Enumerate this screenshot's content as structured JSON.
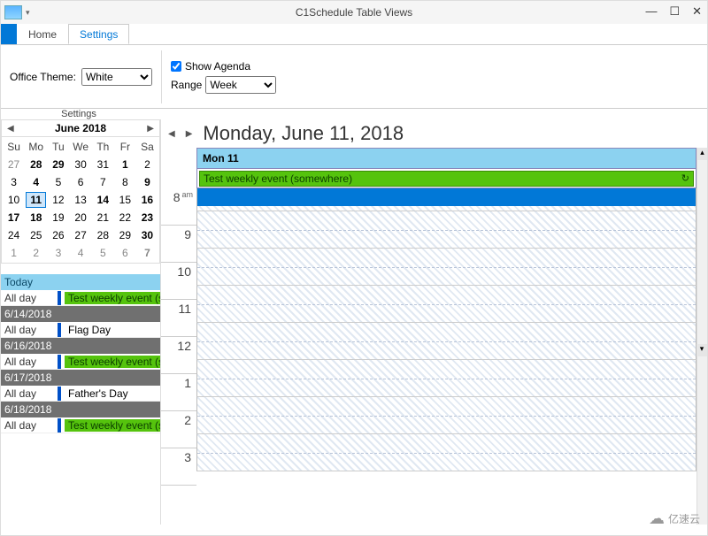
{
  "window": {
    "title": "C1Schedule Table Views"
  },
  "ribbon": {
    "tabs": {
      "home": "Home",
      "settings": "Settings"
    },
    "theme_label": "Office Theme:",
    "theme_value": "White",
    "show_agenda": "Show Agenda",
    "range_label": "Range",
    "range_value": "Week",
    "group_label": "Settings"
  },
  "calendar": {
    "month_label": "June  2018",
    "dow": [
      "Su",
      "Mo",
      "Tu",
      "We",
      "Th",
      "Fr",
      "Sa"
    ],
    "weeks": [
      [
        {
          "d": "27",
          "dim": true
        },
        {
          "d": "28",
          "bold": true
        },
        {
          "d": "29",
          "bold": true
        },
        {
          "d": "30"
        },
        {
          "d": "31"
        },
        {
          "d": "1",
          "bold": true
        },
        {
          "d": "2"
        }
      ],
      [
        {
          "d": "3"
        },
        {
          "d": "4",
          "bold": true
        },
        {
          "d": "5"
        },
        {
          "d": "6"
        },
        {
          "d": "7"
        },
        {
          "d": "8"
        },
        {
          "d": "9",
          "bold": true
        }
      ],
      [
        {
          "d": "10"
        },
        {
          "d": "11",
          "sel": true,
          "bold": true
        },
        {
          "d": "12"
        },
        {
          "d": "13"
        },
        {
          "d": "14",
          "bold": true
        },
        {
          "d": "15"
        },
        {
          "d": "16",
          "bold": true
        }
      ],
      [
        {
          "d": "17",
          "bold": true
        },
        {
          "d": "18",
          "bold": true
        },
        {
          "d": "19"
        },
        {
          "d": "20"
        },
        {
          "d": "21"
        },
        {
          "d": "22"
        },
        {
          "d": "23",
          "bold": true
        }
      ],
      [
        {
          "d": "24"
        },
        {
          "d": "25"
        },
        {
          "d": "26"
        },
        {
          "d": "27"
        },
        {
          "d": "28"
        },
        {
          "d": "29"
        },
        {
          "d": "30",
          "bold": true
        }
      ],
      [
        {
          "d": "1",
          "dim": true
        },
        {
          "d": "2",
          "dim": true
        },
        {
          "d": "3",
          "dim": true
        },
        {
          "d": "4",
          "dim": true
        },
        {
          "d": "5",
          "dim": true
        },
        {
          "d": "6",
          "dim": true
        },
        {
          "d": "7",
          "dim": true,
          "bold": true
        }
      ]
    ]
  },
  "agenda": {
    "today_label": "Today",
    "allday_label": "All day",
    "items": [
      {
        "date": "Today",
        "text": "Test weekly event (somewhere)",
        "green": true
      },
      {
        "date": "6/14/2018",
        "text": "Flag Day",
        "green": false
      },
      {
        "date": "6/16/2018",
        "text": "Test weekly event (somewhere)",
        "green": true
      },
      {
        "date": "6/17/2018",
        "text": "Father's Day",
        "green": false
      },
      {
        "date": "6/18/2018",
        "text": "Test weekly event (somewhere)",
        "green": true
      }
    ]
  },
  "day": {
    "title": "Monday, June 11, 2018",
    "header": "Mon 11",
    "allday_event": "Test weekly event (somewhere)",
    "hours": [
      {
        "h": "8",
        "ap": "am"
      },
      {
        "h": "9",
        "ap": ""
      },
      {
        "h": "10",
        "ap": ""
      },
      {
        "h": "11",
        "ap": ""
      },
      {
        "h": "12",
        "ap": ""
      },
      {
        "h": "1",
        "ap": ""
      },
      {
        "h": "2",
        "ap": ""
      },
      {
        "h": "3",
        "ap": ""
      }
    ]
  },
  "watermark": "亿速云"
}
